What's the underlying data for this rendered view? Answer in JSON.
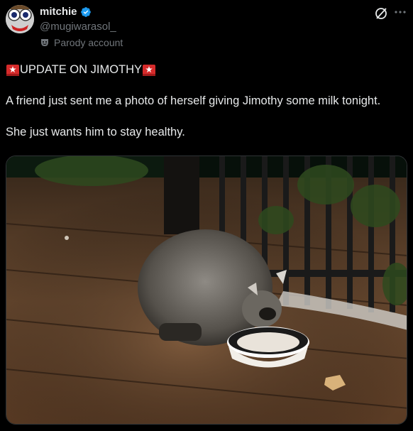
{
  "author": {
    "display_name": "mitchie",
    "handle": "@mugiwarasol_",
    "label": "Parody account"
  },
  "icons": {
    "avatar": "avatar-image",
    "verified": "verified-badge-icon",
    "parody": "theater-mask-icon",
    "grok": "grok-icon",
    "more": "more-icon",
    "siren": "police-siren-emoji"
  },
  "tweet": {
    "headline": "UPDATE ON JIMOTHY",
    "paragraph1": "A friend just sent me a photo of herself giving Jimothy some milk tonight.",
    "paragraph2": "She just wants him to stay healthy."
  },
  "colors": {
    "background": "#000000",
    "text": "#e7e9ea",
    "muted": "#71767b",
    "verified": "#1d9bf0"
  }
}
